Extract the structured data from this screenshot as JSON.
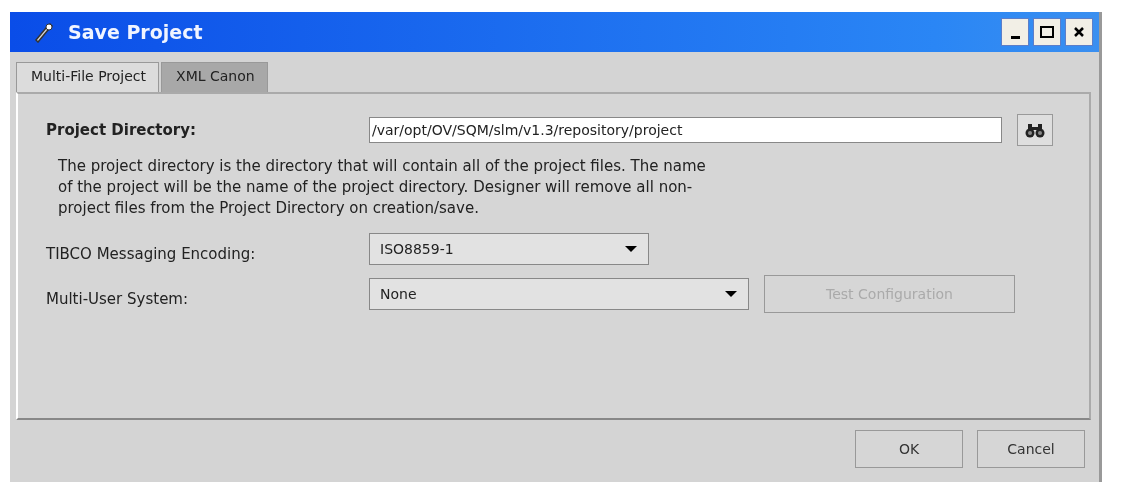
{
  "window": {
    "title": "Save Project"
  },
  "tabs": [
    {
      "label": "Multi-File Project",
      "selected": true
    },
    {
      "label": "XML Canon",
      "selected": false
    }
  ],
  "project_directory": {
    "label": "Project Directory:",
    "value": "/var/opt/OV/SQM/slm/v1.3/repository/project"
  },
  "description": "The project directory is the directory that will contain all of the project files. The name of the project will be the name of the project directory. Designer will remove all non-project files from the Project Directory on creation/save.",
  "encoding": {
    "label": "TIBCO Messaging Encoding:",
    "value": "ISO8859-1"
  },
  "multi_user": {
    "label": "Multi-User System:",
    "value": "None"
  },
  "test_button": {
    "label": "Test Configuration",
    "disabled": true
  },
  "buttons": [
    {
      "label": "OK"
    },
    {
      "label": "Cancel"
    }
  ]
}
